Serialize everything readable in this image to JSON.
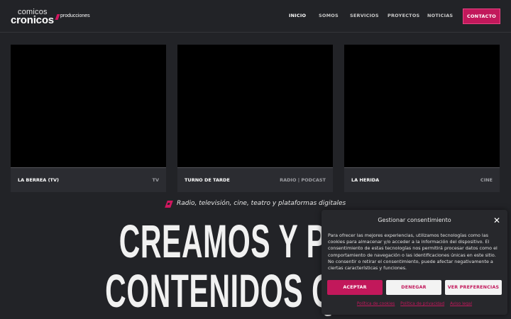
{
  "header": {
    "logo": {
      "line1": "comicos",
      "line2": "cronicos",
      "line3": "producciones"
    },
    "nav": [
      {
        "label": "INICIO",
        "active": true
      },
      {
        "label": "SOMOS",
        "active": false
      },
      {
        "label": "SERVICIOS",
        "active": false
      },
      {
        "label": "PROYECTOS",
        "active": false
      },
      {
        "label": "NOTICIAS",
        "active": false
      }
    ],
    "contact_label": "CONTACTO"
  },
  "cards": [
    {
      "title": "LA BERREA (TV)",
      "category": "TV"
    },
    {
      "title": "TURNO DE TARDE",
      "category": "RADIO | PODCAST"
    },
    {
      "title": "LA HERIDA",
      "category": "CINE"
    }
  ],
  "hero": {
    "tagline": "Radio, televisión, cine, teatro y plataformas digitales",
    "headline_line1": "CREAMOS Y PROD",
    "headline_line2": "CONTENIDOS QUE C"
  },
  "cookie": {
    "title": "Gestionar consentimiento",
    "body": "Para ofrecer las mejores experiencias, utilizamos tecnologías como las cookies para almacenar y/o acceder a la información del dispositivo. El consentimiento de estas tecnologías nos permitirá procesar datos como el comportamiento de navegación o las identificaciones únicas en este sitio. No consentir o retirar el consentimiento, puede afectar negativamente a ciertas características y funciones.",
    "accept_label": "ACEPTAR",
    "deny_label": "DENEGAR",
    "prefs_label": "VER PREFERENCIAS",
    "links": [
      "Política de cookies",
      "Política de privacidad",
      "Aviso legal"
    ]
  },
  "colors": {
    "accent": "#c2185b",
    "background": "#222327",
    "card": "#2b2c31"
  }
}
